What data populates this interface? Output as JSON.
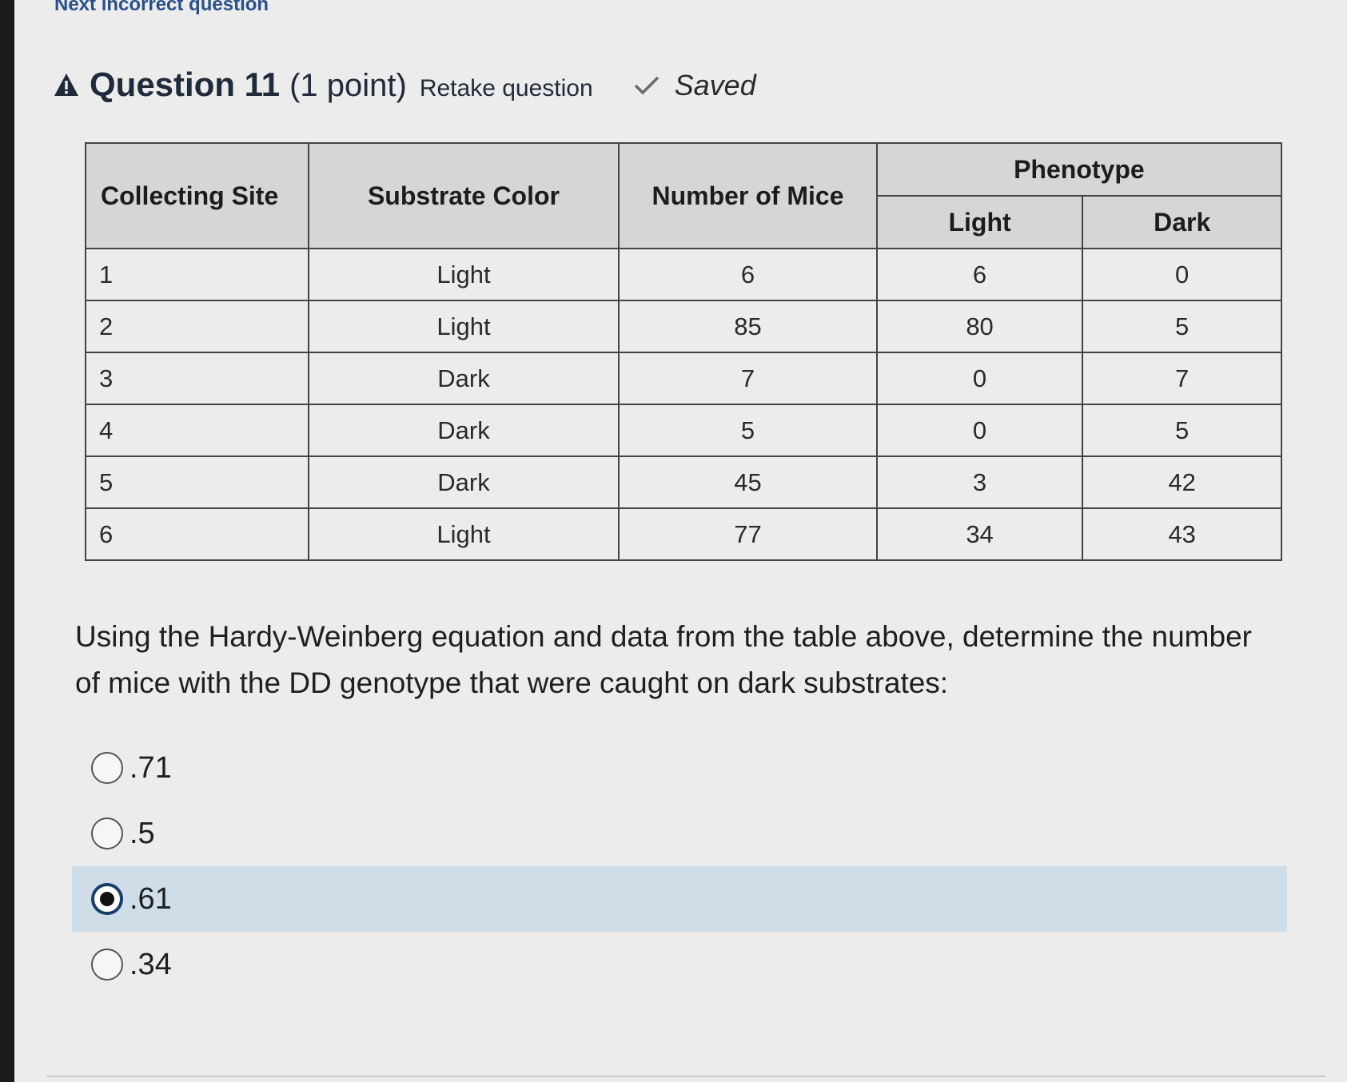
{
  "nav": {
    "next_incorrect": "Next incorrect question"
  },
  "question": {
    "title": "Question 11",
    "points": "(1 point)",
    "retake": "Retake question",
    "status": "Saved",
    "prompt": "Using the Hardy-Weinberg equation and data from the table above, determine the number of mice with the DD genotype that were caught on dark substrates:"
  },
  "table": {
    "headers": {
      "site": "Collecting Site",
      "substrate": "Substrate Color",
      "mice": "Number of Mice",
      "phenotype": "Phenotype",
      "light": "Light",
      "dark": "Dark"
    },
    "rows": [
      [
        "1",
        "Light",
        "6",
        "6",
        "0"
      ],
      [
        "2",
        "Light",
        "85",
        "80",
        "5"
      ],
      [
        "3",
        "Dark",
        "7",
        "0",
        "7"
      ],
      [
        "4",
        "Dark",
        "5",
        "0",
        "5"
      ],
      [
        "5",
        "Dark",
        "45",
        "3",
        "42"
      ],
      [
        "6",
        "Light",
        "77",
        "34",
        "43"
      ]
    ]
  },
  "options": [
    {
      "label": ".71",
      "selected": false
    },
    {
      "label": ".5",
      "selected": false
    },
    {
      "label": ".61",
      "selected": true
    },
    {
      "label": ".34",
      "selected": false
    }
  ],
  "colors": {
    "selected_bg": "#cfdde8",
    "radio_selected_ring": "#1b3d6b",
    "header_text": "#1f2a3a",
    "link": "#2a4f8a"
  }
}
